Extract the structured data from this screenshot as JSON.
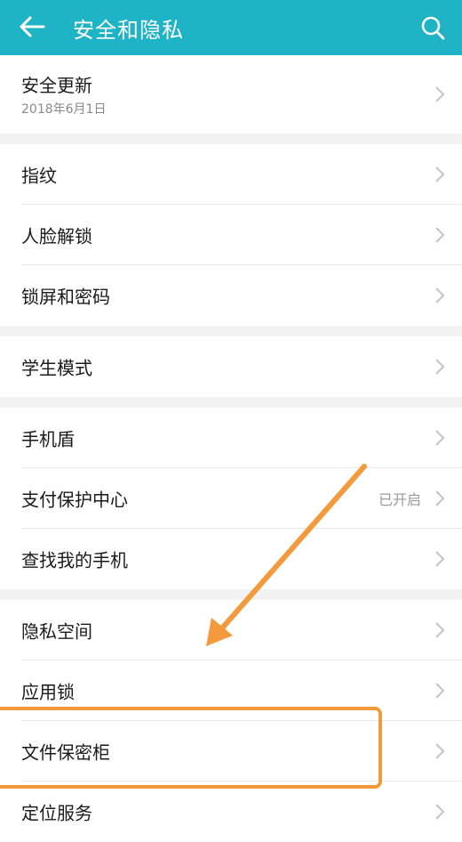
{
  "colors": {
    "header_bg": "#1fb3c6",
    "annotation": "#f39a3c"
  },
  "header": {
    "title": "安全和隐私",
    "back_icon": "arrow-left-icon",
    "search_icon": "search-icon"
  },
  "groups": [
    {
      "items": [
        {
          "label": "安全更新",
          "sub": "2018年6月1日"
        }
      ]
    },
    {
      "items": [
        {
          "label": "指纹"
        },
        {
          "label": "人脸解锁"
        },
        {
          "label": "锁屏和密码"
        }
      ]
    },
    {
      "items": [
        {
          "label": "学生模式"
        }
      ]
    },
    {
      "items": [
        {
          "label": "手机盾"
        },
        {
          "label": "支付保护中心",
          "value": "已开启"
        },
        {
          "label": "查找我的手机"
        }
      ]
    },
    {
      "items": [
        {
          "label": "隐私空间"
        },
        {
          "label": "应用锁"
        },
        {
          "label": "文件保密柜"
        },
        {
          "label": "定位服务",
          "value": ""
        }
      ]
    }
  ]
}
